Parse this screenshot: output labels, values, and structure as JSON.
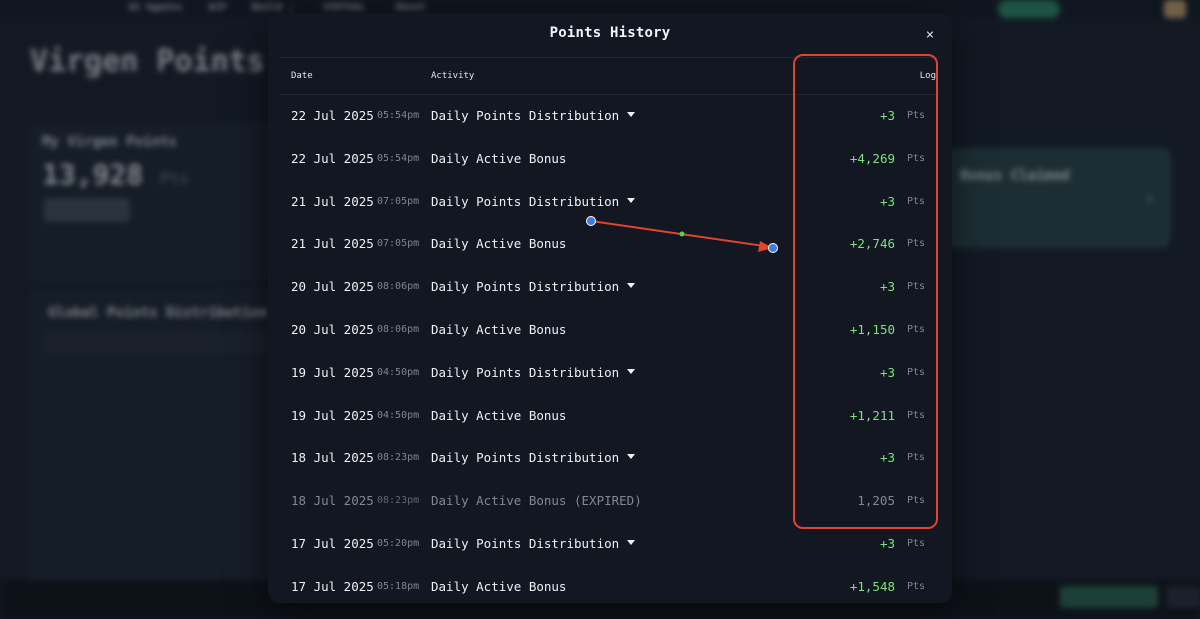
{
  "modal": {
    "title": "Points History",
    "close_symbol": "×",
    "columns": {
      "date": "Date",
      "activity": "Activity",
      "log": "Log"
    },
    "rows": [
      {
        "date": "22 Jul 2025",
        "time": "05:54pm",
        "activity": "Daily Points Distribution",
        "expandable": true,
        "log": "+3",
        "unit": "Pts",
        "expired": false
      },
      {
        "date": "22 Jul 2025",
        "time": "05:54pm",
        "activity": "Daily Active Bonus",
        "expandable": false,
        "log": "+4,269",
        "unit": "Pts",
        "expired": false
      },
      {
        "date": "21 Jul 2025",
        "time": "07:05pm",
        "activity": "Daily Points Distribution",
        "expandable": true,
        "log": "+3",
        "unit": "Pts",
        "expired": false
      },
      {
        "date": "21 Jul 2025",
        "time": "07:05pm",
        "activity": "Daily Active Bonus",
        "expandable": false,
        "log": "+2,746",
        "unit": "Pts",
        "expired": false
      },
      {
        "date": "20 Jul 2025",
        "time": "08:06pm",
        "activity": "Daily Points Distribution",
        "expandable": true,
        "log": "+3",
        "unit": "Pts",
        "expired": false
      },
      {
        "date": "20 Jul 2025",
        "time": "08:06pm",
        "activity": "Daily Active Bonus",
        "expandable": false,
        "log": "+1,150",
        "unit": "Pts",
        "expired": false
      },
      {
        "date": "19 Jul 2025",
        "time": "04:50pm",
        "activity": "Daily Points Distribution",
        "expandable": true,
        "log": "+3",
        "unit": "Pts",
        "expired": false
      },
      {
        "date": "19 Jul 2025",
        "time": "04:50pm",
        "activity": "Daily Active Bonus",
        "expandable": false,
        "log": "+1,211",
        "unit": "Pts",
        "expired": false
      },
      {
        "date": "18 Jul 2025",
        "time": "08:23pm",
        "activity": "Daily Points Distribution",
        "expandable": true,
        "log": "+3",
        "unit": "Pts",
        "expired": false
      },
      {
        "date": "18 Jul 2025",
        "time": "08:23pm",
        "activity": "Daily Active Bonus (EXPIRED)",
        "expandable": false,
        "log": "1,205",
        "unit": "Pts",
        "expired": true
      },
      {
        "date": "17 Jul 2025",
        "time": "05:20pm",
        "activity": "Daily Points Distribution",
        "expandable": true,
        "log": "+3",
        "unit": "Pts",
        "expired": false
      },
      {
        "date": "17 Jul 2025",
        "time": "05:18pm",
        "activity": "Daily Active Bonus",
        "expandable": false,
        "log": "+1,548",
        "unit": "Pts",
        "expired": false
      }
    ]
  },
  "background": {
    "page_title": "Virgen Points",
    "nav": [
      "AI Agents",
      "ACP",
      "Build ⌄",
      "VIRTUAL",
      "About"
    ],
    "card_title": "My Virgen Points",
    "points_total": "13,928",
    "points_unit": "Pts",
    "global_title": "Global Points Distribution",
    "teal_card_title": "Bonus Claimed"
  },
  "colors": {
    "positive": "#7ee07f",
    "annotation": "#e0442d",
    "modal_bg": "#121722"
  }
}
